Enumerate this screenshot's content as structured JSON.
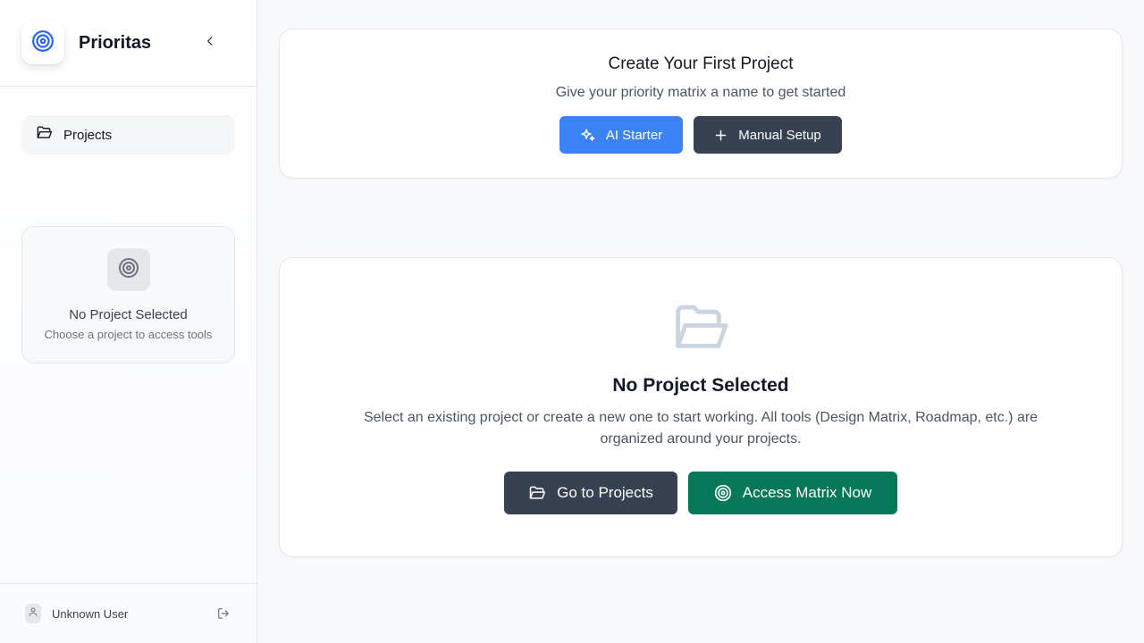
{
  "app": {
    "name": "Prioritas"
  },
  "sidebar": {
    "nav": [
      {
        "label": "Projects",
        "icon": "folder-open-icon"
      }
    ],
    "no_project_card": {
      "title": "No Project Selected",
      "subtitle": "Choose a project to access tools",
      "icon": "target-icon"
    },
    "user": {
      "name": "Unknown User"
    }
  },
  "create_card": {
    "title": "Create Your First Project",
    "subtitle": "Give your priority matrix a name to get started",
    "ai_button": "AI Starter",
    "manual_button": "Manual Setup"
  },
  "empty_state": {
    "title": "No Project Selected",
    "description": "Select an existing project or create a new one to start working. All tools (Design Matrix, Roadmap, etc.) are organized around your projects.",
    "go_button": "Go to Projects",
    "access_button": "Access Matrix Now"
  },
  "colors": {
    "primary_blue": "#3b82f6",
    "dark": "#374151",
    "green": "#047857"
  }
}
